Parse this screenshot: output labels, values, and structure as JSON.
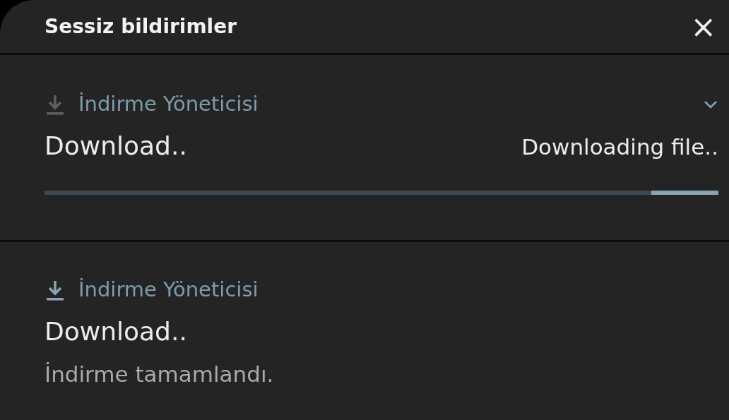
{
  "header": {
    "title": "Sessiz bildirimler",
    "close_label": "×"
  },
  "notifications": [
    {
      "kind": "progress",
      "app": "İndirme Yöneticisi",
      "expandable": true,
      "title": "Download..",
      "status": "Downloading file..",
      "indeterminate": true
    },
    {
      "kind": "complete",
      "app": "İndirme Yöneticisi",
      "expandable": false,
      "title": "Download..",
      "text": "İndirme tamamlandı."
    }
  ]
}
